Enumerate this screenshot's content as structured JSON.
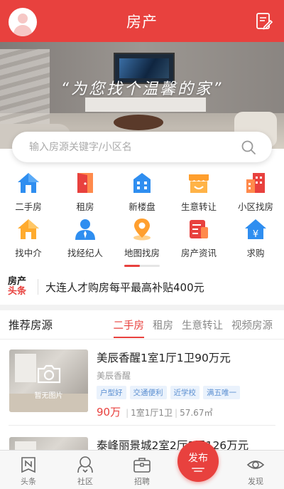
{
  "header": {
    "title": "房产"
  },
  "banner": {
    "slogan": "“为您找个温馨的家”"
  },
  "search": {
    "placeholder": "输入房源关键字/小区名"
  },
  "categories": [
    {
      "label": "二手房",
      "icon": "house-icon"
    },
    {
      "label": "租房",
      "icon": "door-icon"
    },
    {
      "label": "新楼盘",
      "icon": "building-icon"
    },
    {
      "label": "生意转让",
      "icon": "shop-icon"
    },
    {
      "label": "小区找房",
      "icon": "apartment-icon"
    },
    {
      "label": "找中介",
      "icon": "agency-house-icon"
    },
    {
      "label": "找经纪人",
      "icon": "agent-person-icon"
    },
    {
      "label": "地图找房",
      "icon": "map-pin-icon"
    },
    {
      "label": "房产资讯",
      "icon": "news-icon"
    },
    {
      "label": "求购",
      "icon": "yen-house-icon"
    }
  ],
  "headline": {
    "logo_top": "房产",
    "logo_bottom": "头条",
    "text": "大连人才购房每平最高补贴400元"
  },
  "recommend": {
    "title": "推荐房源",
    "tabs": [
      "二手房",
      "租房",
      "生意转让",
      "视频房源"
    ],
    "active_tab": 0
  },
  "listings": [
    {
      "title": "美辰香醒1室1厅1卫90万元",
      "community": "美辰香醒",
      "tags": [
        "户型好",
        "交通便利",
        "近学校",
        "满五唯一"
      ],
      "price": "90万",
      "layout": "1室1厅1卫",
      "area": "57.67㎡",
      "no_image": "暂无图片"
    },
    {
      "title": "泰峰丽景城2室2厅1卫126万元"
    }
  ],
  "nav": [
    {
      "label": "头条",
      "icon": "news-n-icon"
    },
    {
      "label": "社区",
      "icon": "community-icon"
    },
    {
      "label": "招聘",
      "icon": "briefcase-icon"
    },
    {
      "label": "发布",
      "icon": "publish-icon"
    },
    {
      "label": "发现",
      "icon": "eye-icon"
    }
  ],
  "colors": {
    "primary": "#e8413e",
    "tag_text": "#5b8fd1",
    "tag_bg": "#eaf2fc"
  }
}
